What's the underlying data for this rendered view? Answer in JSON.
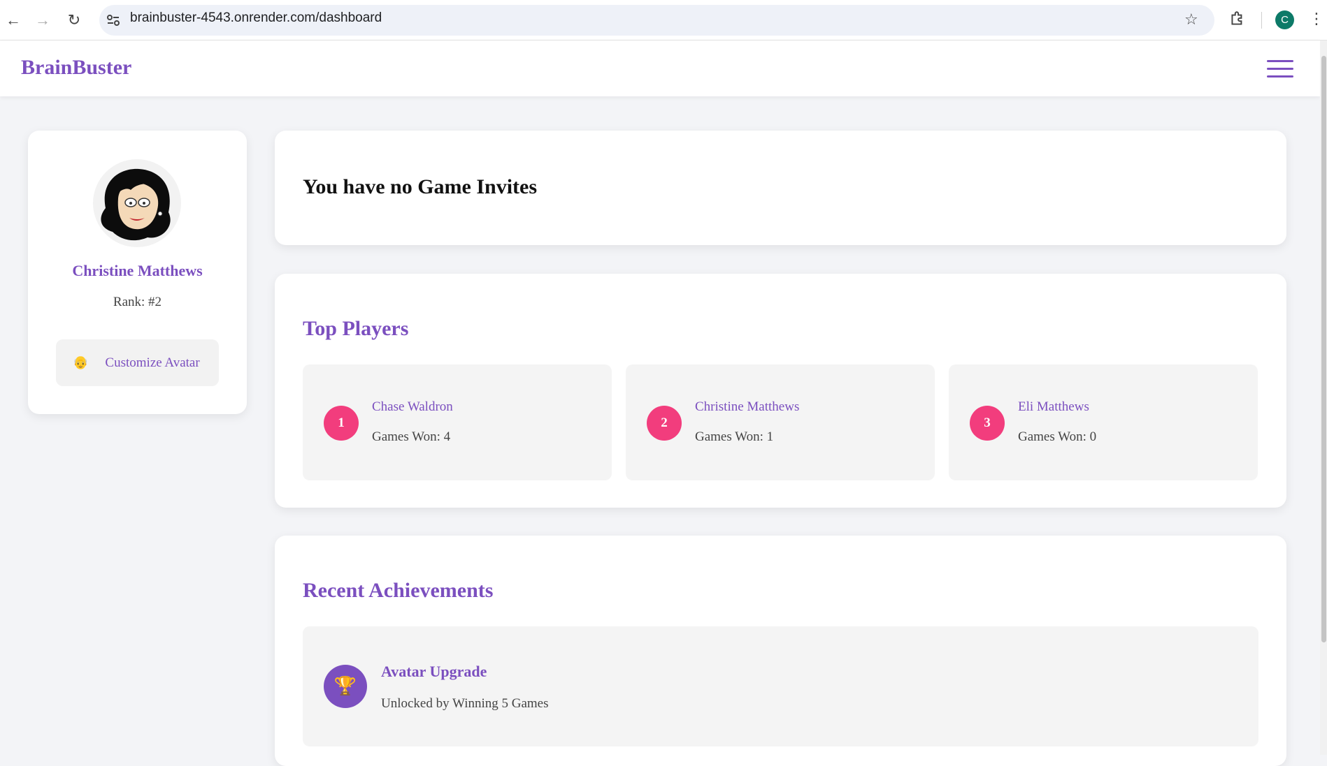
{
  "browser": {
    "url": "brainbuster-4543.onrender.com/dashboard",
    "profile_initial": "C"
  },
  "header": {
    "brand": "BrainBuster"
  },
  "profile": {
    "name": "Christine Matthews",
    "rank": "Rank: #2",
    "customize_label": "Customize Avatar",
    "customize_icon": "👴"
  },
  "invites": {
    "title": "You have no Game Invites"
  },
  "top_players": {
    "title": "Top Players",
    "players": [
      {
        "rank": "1",
        "name": "Chase Waldron",
        "wins": "Games Won: 4"
      },
      {
        "rank": "2",
        "name": "Christine Matthews",
        "wins": "Games Won: 1"
      },
      {
        "rank": "3",
        "name": "Eli Matthews",
        "wins": "Games Won: 0"
      }
    ]
  },
  "achievements": {
    "title": "Recent Achievements",
    "items": [
      {
        "icon": "🏆",
        "title": "Avatar Upgrade",
        "description": "Unlocked by Winning 5 Games"
      }
    ]
  },
  "colors": {
    "accent": "#7b4fbf",
    "rank_badge": "#f23d7d",
    "page_bg": "#f3f4f7"
  }
}
